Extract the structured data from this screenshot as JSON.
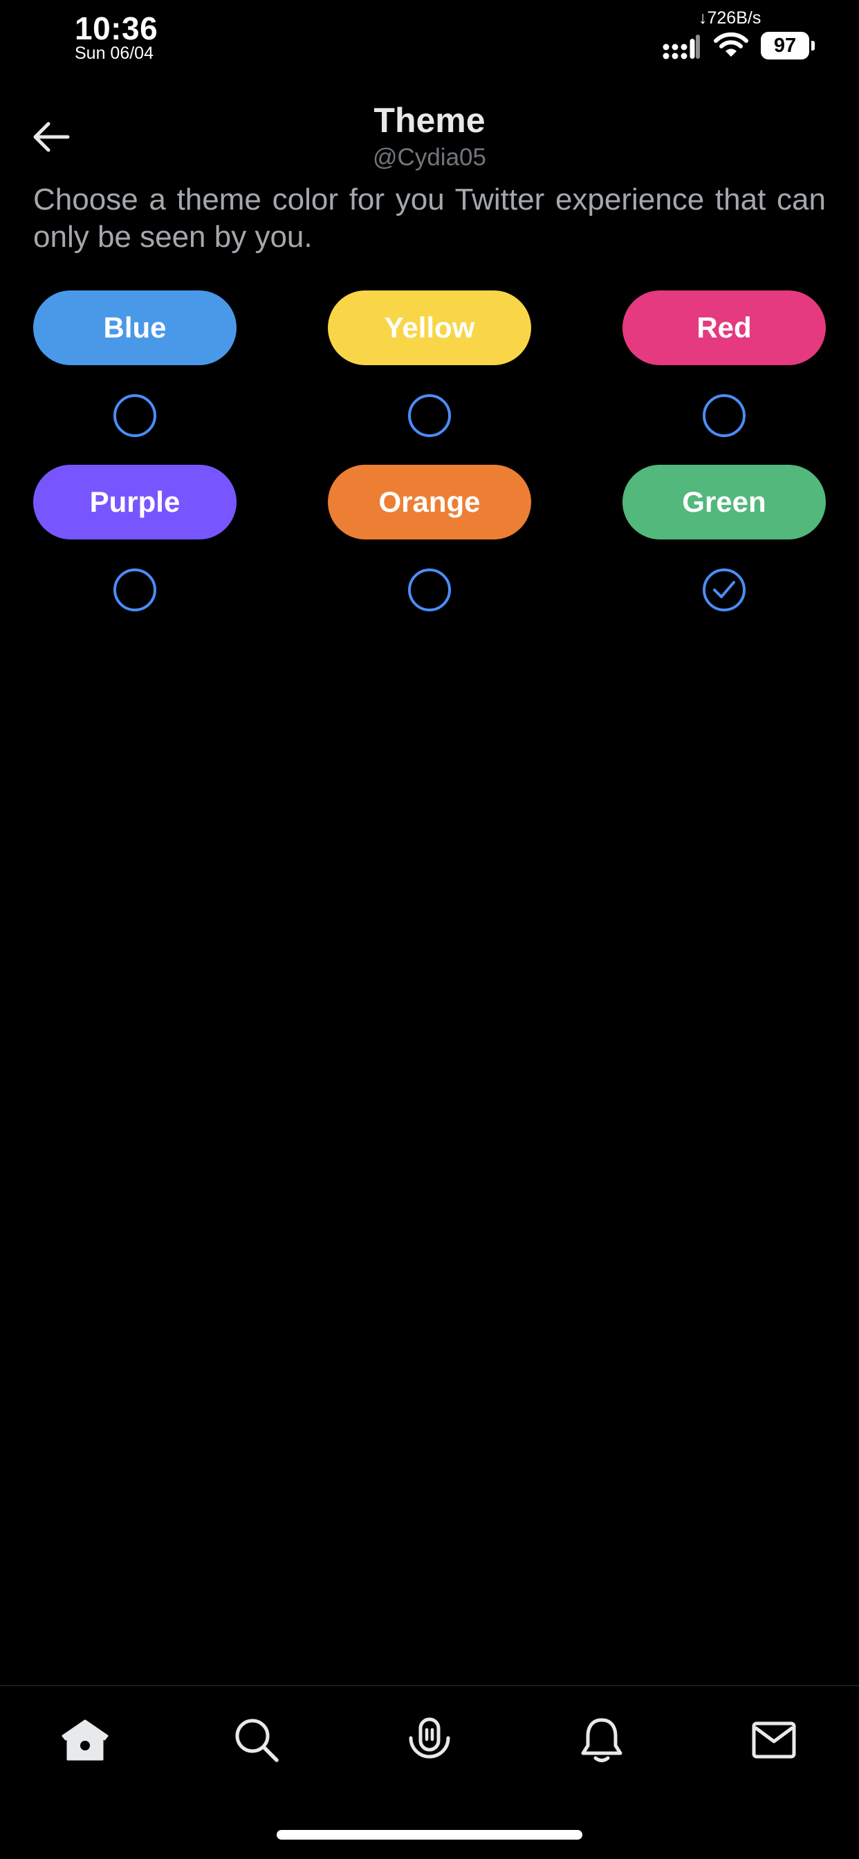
{
  "status_bar": {
    "time": "10:36",
    "date": "Sun 06/04",
    "network_speed": "↓726B/s",
    "battery": "97"
  },
  "header": {
    "title": "Theme",
    "username": "@Cydia05",
    "back_icon": "arrow-left-icon"
  },
  "description": "Choose a theme color for you Twitter experience that can only be seen by you.",
  "themes": [
    {
      "label": "Blue",
      "color": "#4a99e9",
      "selected": false
    },
    {
      "label": "Yellow",
      "color": "#f8d648",
      "selected": false
    },
    {
      "label": "Red",
      "color": "#e53a7f",
      "selected": false
    },
    {
      "label": "Purple",
      "color": "#7856ff",
      "selected": false
    },
    {
      "label": "Orange",
      "color": "#ed7f34",
      "selected": false
    },
    {
      "label": "Green",
      "color": "#52b87c",
      "selected": true
    }
  ],
  "accent_color": "#4a8df8",
  "tab_bar": [
    {
      "icon": "home-icon",
      "active": true
    },
    {
      "icon": "search-icon",
      "active": false
    },
    {
      "icon": "spaces-microphone-icon",
      "active": false
    },
    {
      "icon": "notifications-bell-icon",
      "active": false
    },
    {
      "icon": "messages-envelope-icon",
      "active": false
    }
  ]
}
